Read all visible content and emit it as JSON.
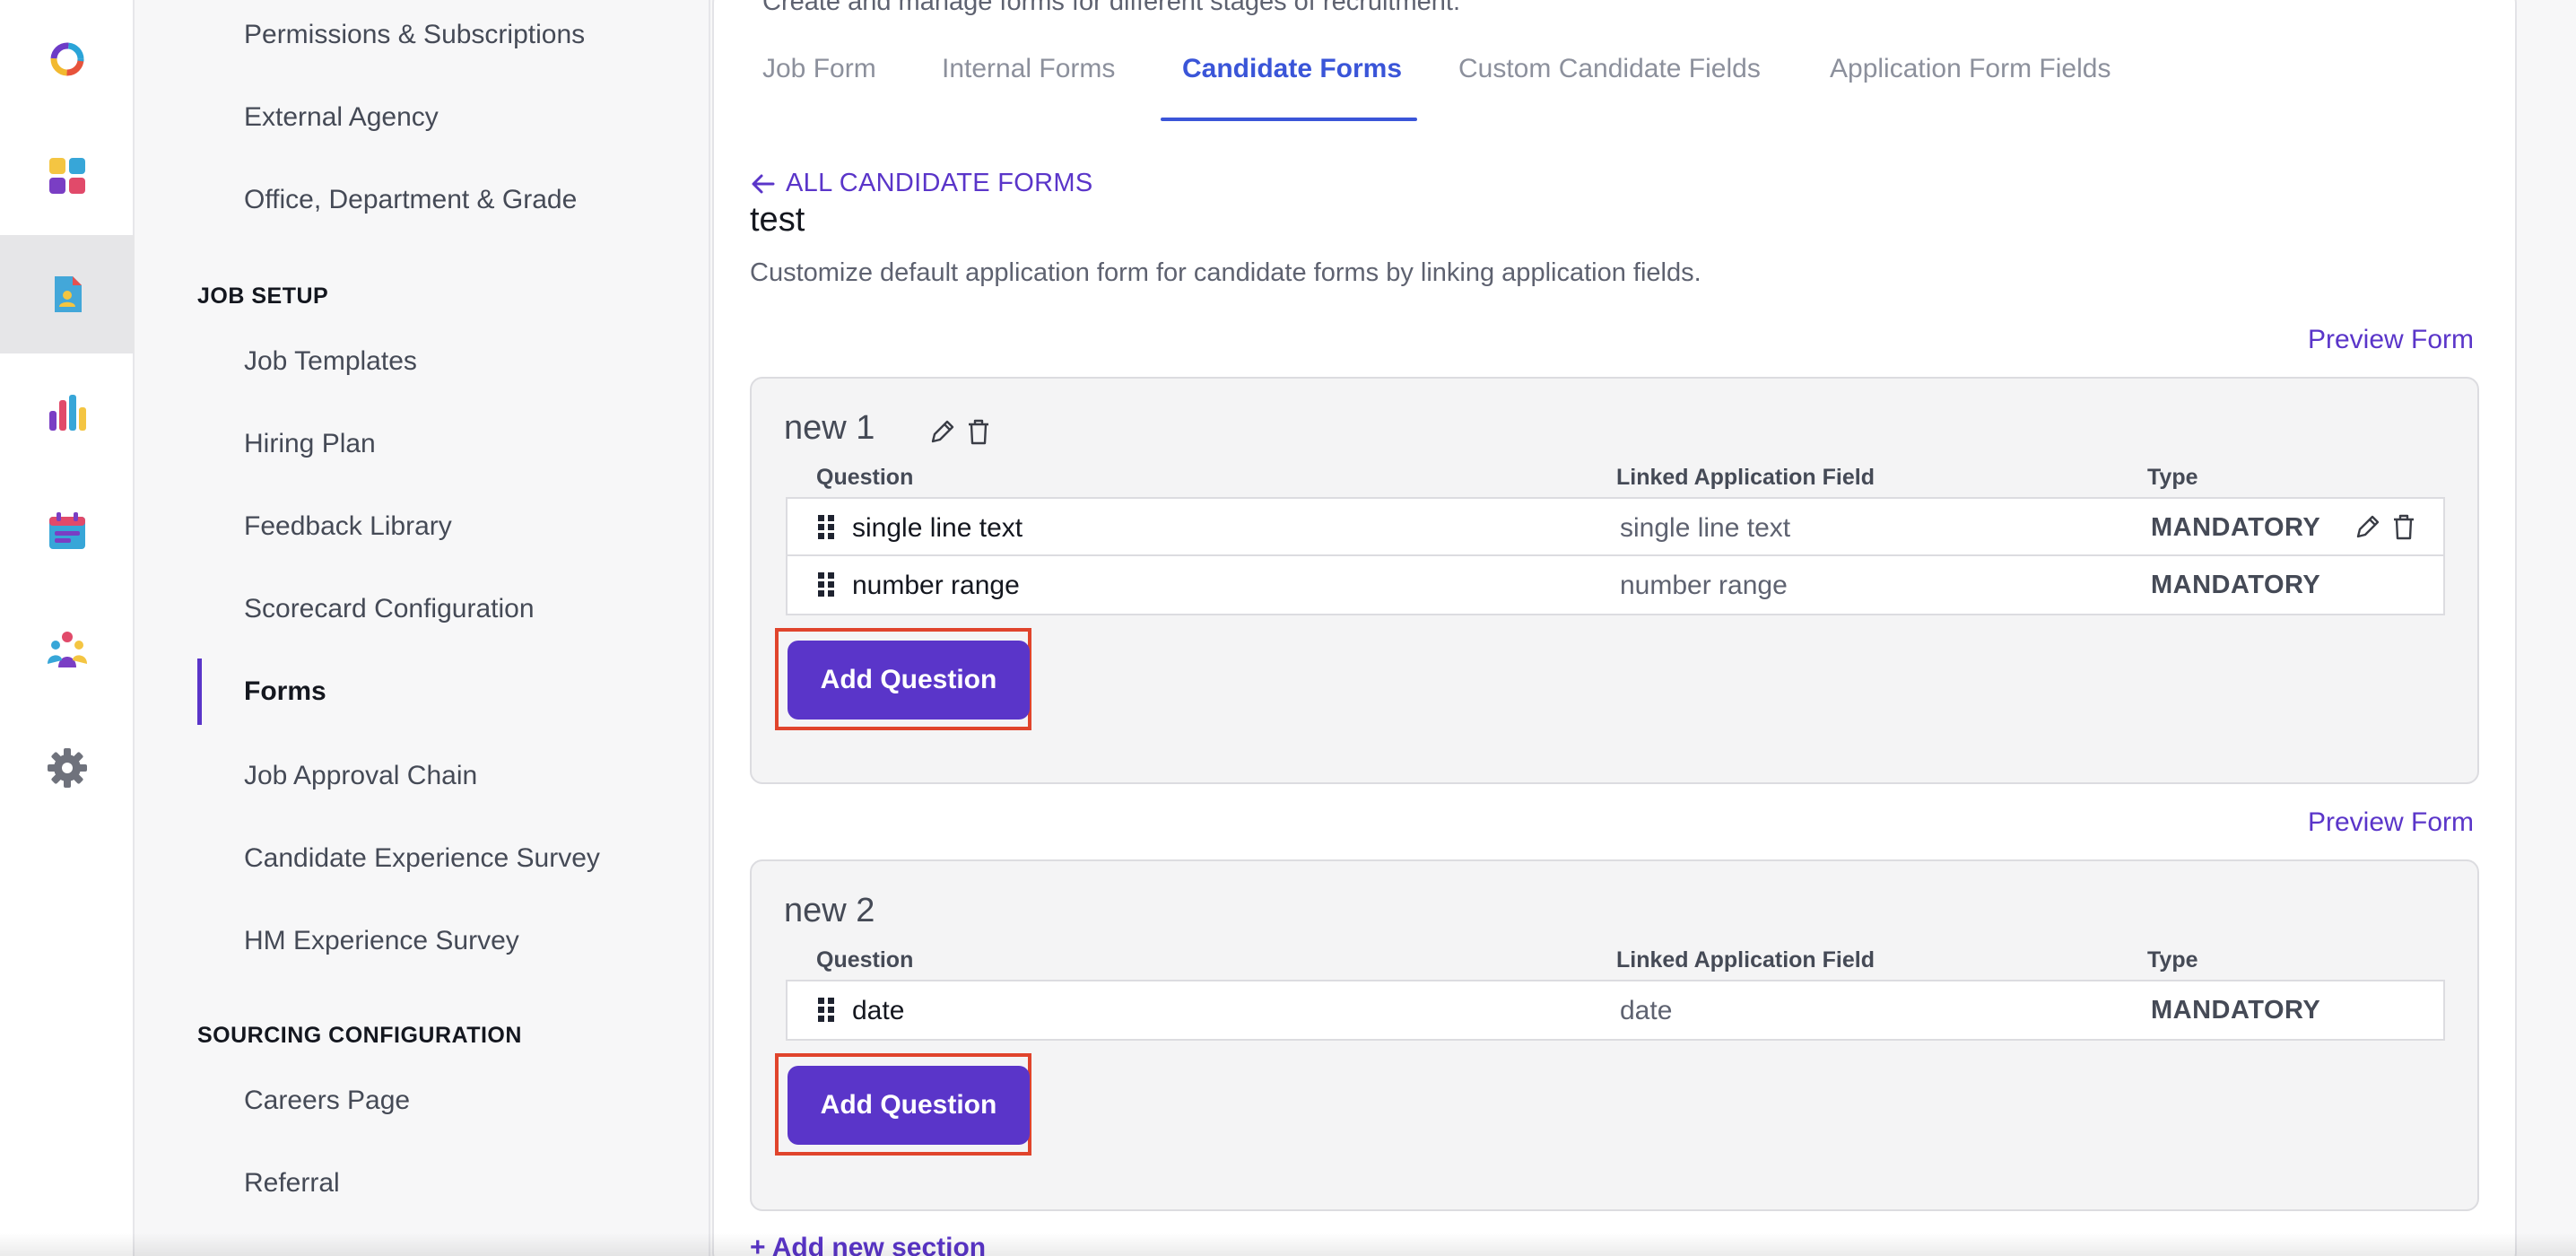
{
  "rail": {
    "items": [
      {
        "icon": "logo-ring-icon"
      },
      {
        "icon": "dashboard-grid-icon"
      },
      {
        "icon": "document-person-icon"
      },
      {
        "icon": "bar-chart-icon"
      },
      {
        "icon": "calendar-icon"
      },
      {
        "icon": "people-icon"
      },
      {
        "icon": "gear-icon"
      }
    ]
  },
  "subnav": {
    "items_top": [
      "Permissions & Subscriptions",
      "External Agency",
      "Office, Department & Grade"
    ],
    "job_setup_header": "JOB SETUP",
    "job_setup_items": [
      "Job Templates",
      "Hiring Plan",
      "Feedback Library",
      "Scorecard Configuration",
      "Forms",
      "Job Approval Chain",
      "Candidate Experience Survey",
      "HM Experience Survey"
    ],
    "sourcing_header": "SOURCING CONFIGURATION",
    "sourcing_items": [
      "Careers Page",
      "Referral"
    ]
  },
  "main": {
    "intro": "Create and manage forms for different stages of recruitment.",
    "tabs": [
      {
        "label": "Job Form"
      },
      {
        "label": "Internal Forms"
      },
      {
        "label": "Candidate Forms"
      },
      {
        "label": "Custom Candidate Fields"
      },
      {
        "label": "Application Form Fields"
      }
    ],
    "back_link": "ALL CANDIDATE FORMS",
    "form_title": "test",
    "form_description": "Customize default application form for candidate forms by linking application fields.",
    "preview_label": "Preview Form",
    "columns": {
      "question": "Question",
      "linked": "Linked Application Field",
      "type": "Type"
    },
    "sections": [
      {
        "name": "new 1",
        "rows": [
          {
            "question": "single line text",
            "linked": "single line text",
            "type": "MANDATORY"
          },
          {
            "question": "number range",
            "linked": "number range",
            "type": "MANDATORY"
          }
        ],
        "add_label": "Add Question"
      },
      {
        "name": "new 2",
        "rows": [
          {
            "question": "date",
            "linked": "date",
            "type": "MANDATORY"
          }
        ],
        "add_label": "Add Question"
      }
    ],
    "add_section_label": "+ Add new section"
  },
  "colors": {
    "accent": "#5a35c9",
    "tab_active": "#3a55d8",
    "highlight": "#e0442c"
  }
}
